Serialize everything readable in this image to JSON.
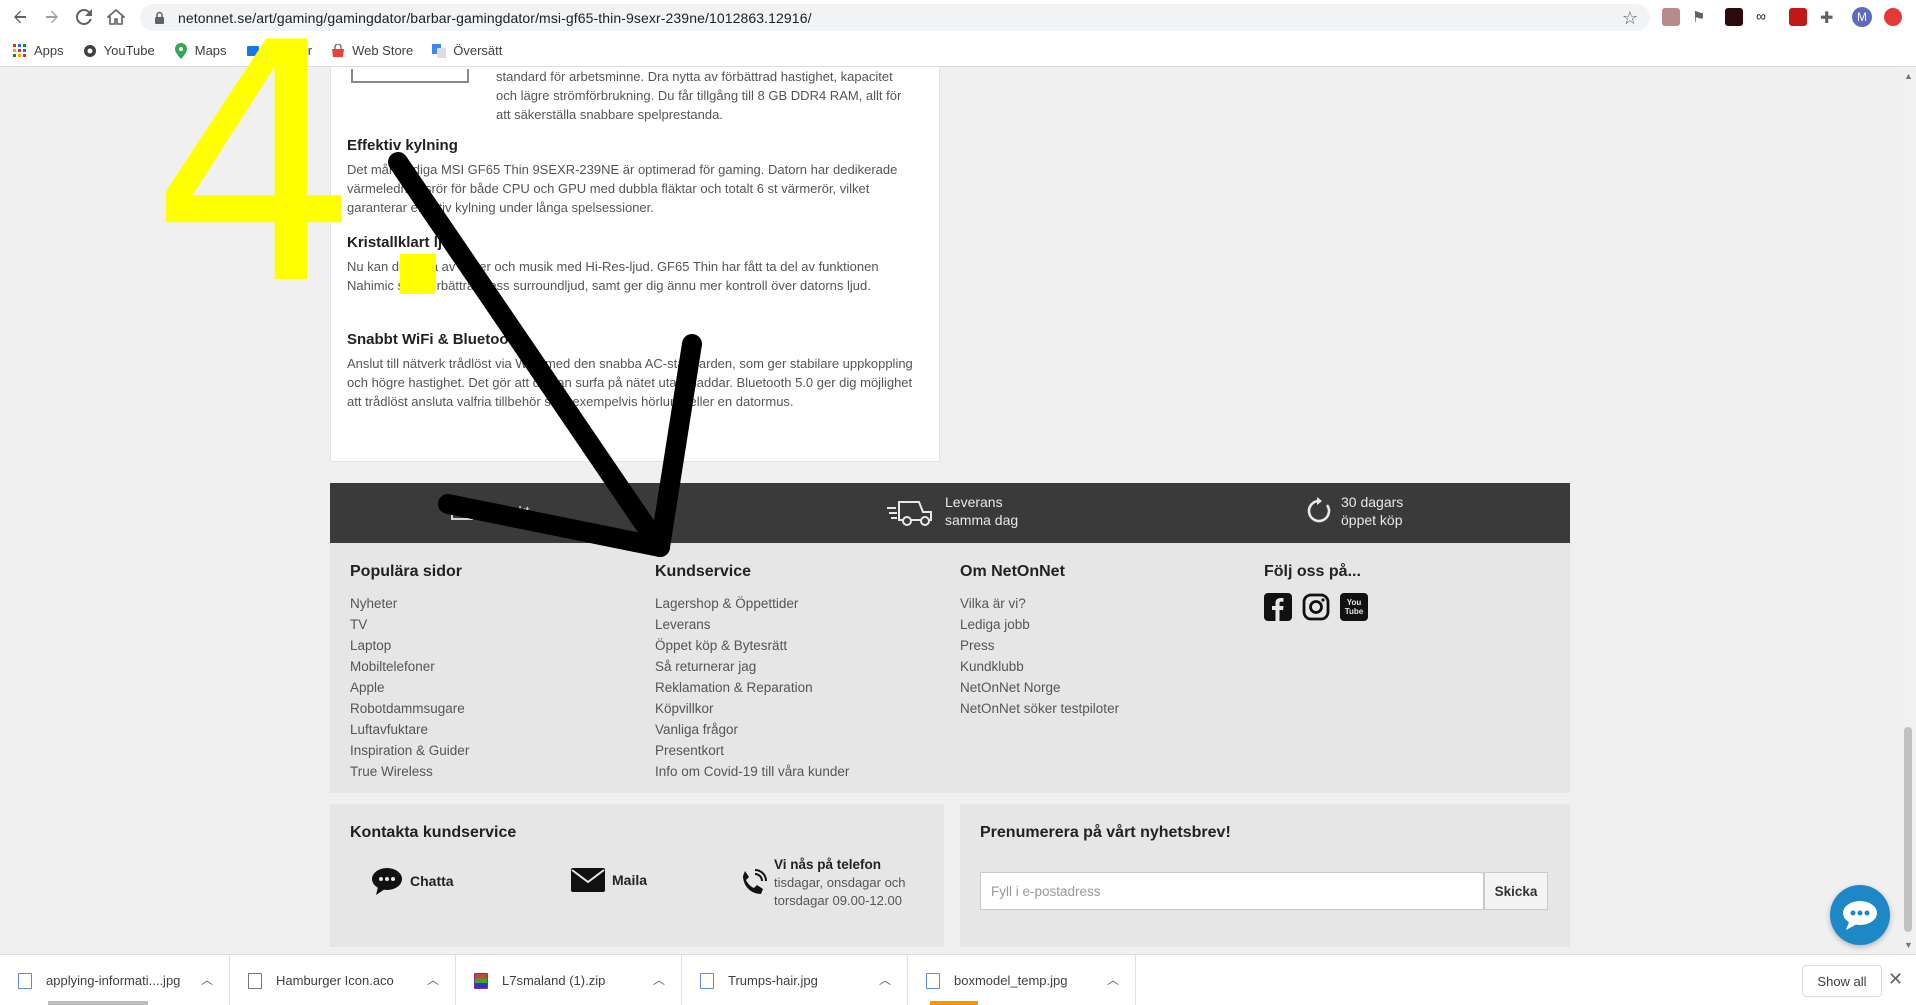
{
  "browser": {
    "url": "netonnet.se/art/gaming/gamingdator/barbar-gamingdator/msi-gf65-thin-9sexr-239ne/1012863.12916/",
    "bookmarks": [
      "Apps",
      "YouTube",
      "Maps",
      "Nyheter",
      "Web Store",
      "Översätt"
    ],
    "profile_initial": "M"
  },
  "product": {
    "ram_text": "standard för arbetsminne. Dra nytta av förbättrad hastighet, kapacitet och lägre strömförbrukning. Du får tillgång till 8 GB DDR4 RAM, allt för att säkerställa snabbare spelprestanda.",
    "sections": [
      {
        "heading": "Effektiv kylning",
        "text": "Det mångsidiga MSI GF65 Thin 9SEXR-239NE är optimerad för gaming. Datorn har dedikerade värmeledningsrör för både CPU och GPU med dubbla fläktar och totalt 6 st värmerör, vilket garanterar effektiv kylning under långa spelsessioner."
      },
      {
        "heading": "Kristallklart ljud",
        "text": "Nu kan du njuta av filmer och musik med Hi-Res-ljud. GF65 Thin har fått ta del av funktionen Nahimic som förbättrar dess surroundljud, samt ger dig ännu mer kontroll över datorns ljud."
      },
      {
        "heading": "Snabbt WiFi & Bluetooth",
        "text": "Anslut till nätverk trådlöst via WiFi med den snabba AC-standarden, som ger stabilare uppkoppling och högre hastighet. Det gör att du kan surfa på nätet utan sladdar. Bluetooth 5.0 ger dig möjlighet att trådlöst ansluta valfria tillbehör som exempelvis hörlurar eller en datormus."
      }
    ]
  },
  "usp": {
    "free_shipping": "Fri frakt",
    "delivery_line1": "Leverans",
    "delivery_line2": "samma dag",
    "return_line1": "30 dagars",
    "return_line2": "öppet köp"
  },
  "footer": {
    "popular": {
      "title": "Populära sidor",
      "links": [
        "Nyheter",
        "TV",
        "Laptop",
        "Mobiltelefoner",
        "Apple",
        "Robotdammsugare",
        "Luftavfuktare",
        "Inspiration & Guider",
        "True Wireless"
      ]
    },
    "service": {
      "title": "Kundservice",
      "links": [
        "Lagershop & Öppettider",
        "Leverans",
        "Öppet köp & Bytesrätt",
        "Så returnerar jag",
        "Reklamation & Reparation",
        "Köpvillkor",
        "Vanliga frågor",
        "Presentkort",
        "Info om Covid-19 till våra kunder"
      ]
    },
    "about": {
      "title": "Om NetOnNet",
      "links": [
        "Vilka är vi?",
        "Lediga jobb",
        "Press",
        "Kundklubb",
        "NetOnNet Norge",
        "NetOnNet söker testpiloter"
      ]
    },
    "follow": {
      "title": "Följ oss på...",
      "youtube_text": "You Tube"
    }
  },
  "contact": {
    "title": "Kontakta kundservice",
    "chat": "Chatta",
    "mail": "Maila",
    "phone_title": "Vi nås på telefon",
    "phone_line1": "tisdagar, onsdagar och",
    "phone_line2": "torsdagar 09.00-12.00"
  },
  "newsletter": {
    "title": "Prenumerera på vårt nyhetsbrev!",
    "placeholder": "Fyll i e-postadress",
    "button": "Skicka"
  },
  "overlay": {
    "number": "4"
  },
  "downloads": {
    "items": [
      "applying-informati....jpg",
      "Hamburger Icon.aco",
      "L7smaland (1).zip",
      "Trumps-hair.jpg",
      "boxmodel_temp.jpg"
    ],
    "show_all": "Show all"
  }
}
